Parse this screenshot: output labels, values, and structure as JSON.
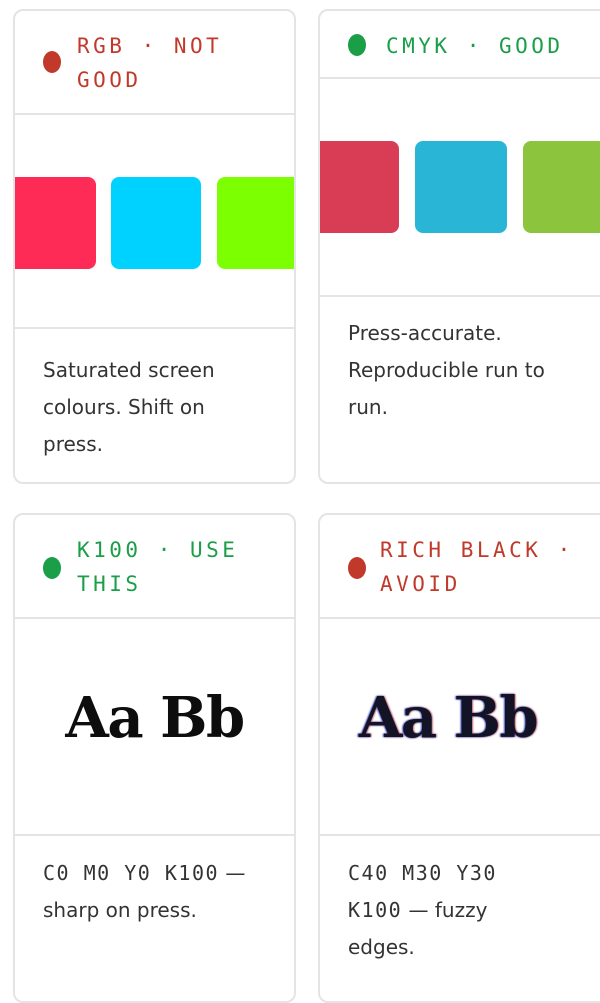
{
  "cards": [
    {
      "label_line1": "RGB · NOT",
      "label_line2": "GOOD",
      "status_color": "#c0392b",
      "swatches": [
        "#ff2b57",
        "#00d2ff",
        "#7cff00"
      ],
      "body_line1": "Saturated screen",
      "body_line2": "colours. Shift on",
      "body_line3": "press."
    },
    {
      "label_line1": "CMYK · GOOD",
      "status_color": "#1a9e47",
      "swatches": [
        "#d93d55",
        "#29b5d6",
        "#8cc43e"
      ],
      "body_line1": "Press-accurate.",
      "body_line2": "Reproducible run to",
      "body_line3": "run."
    },
    {
      "label_line1": "K100 · USE",
      "label_line2": "THIS",
      "status_color": "#1a9e47",
      "sample": "Aa Bb",
      "code": "C0 M0 Y0 K100",
      "body_after_code": " — ",
      "body_line2": "sharp on press."
    },
    {
      "label_line1": "RICH BLACK ·",
      "label_line2": "AVOID",
      "status_color": "#c0392b",
      "sample": "Aa Bb",
      "code_line1": "C40 M30 Y30",
      "code_line2": "K100",
      "body_after_code": " — fuzzy",
      "body_line3": "edges."
    }
  ]
}
